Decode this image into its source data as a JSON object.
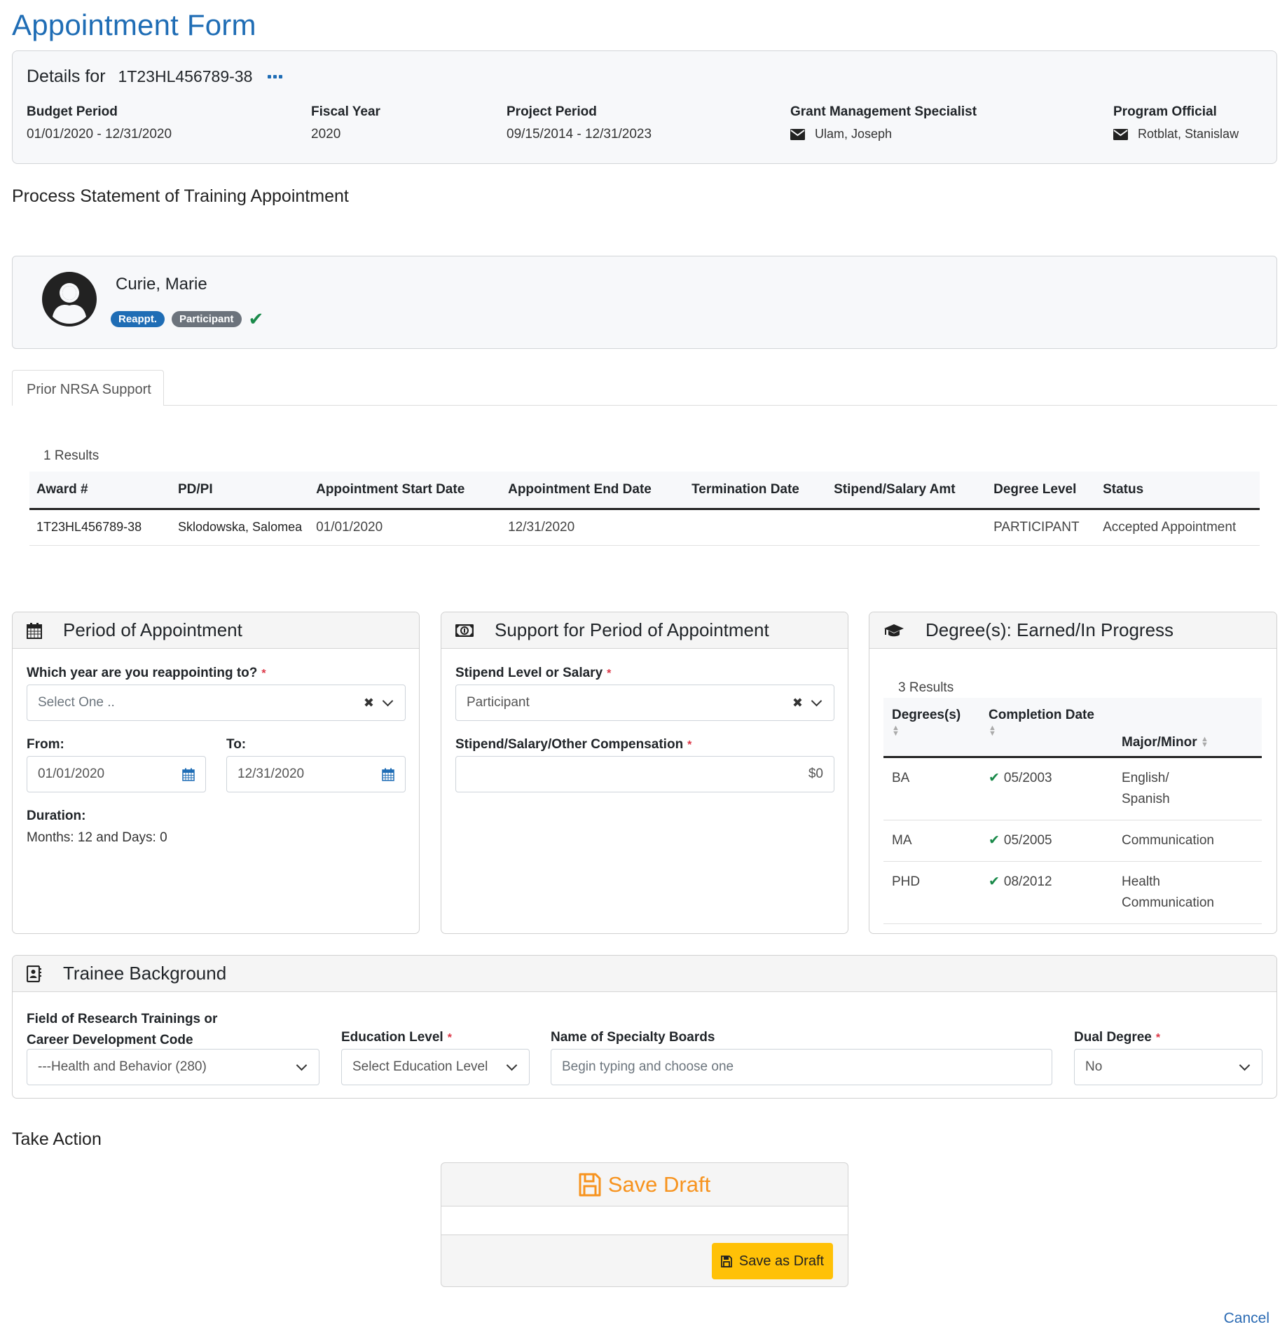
{
  "page": {
    "title": "Appointment Form"
  },
  "details": {
    "heading": "Details for",
    "award_number": "1T23HL456789-38",
    "more_icon": "ellipsis-icon",
    "columns": [
      {
        "label": "Budget Period",
        "value": "01/01/2020 - 12/31/2020"
      },
      {
        "label": "Fiscal Year",
        "value": "2020"
      },
      {
        "label": "Project Period",
        "value": "09/15/2014 - 12/31/2023"
      },
      {
        "label": "Grant Management Specialist",
        "value": "Ulam, Joseph",
        "icon": "envelope-icon"
      },
      {
        "label": "Program Official",
        "value": "Rotblat, Stanislaw",
        "icon": "envelope-icon"
      }
    ]
  },
  "process_title": "Process Statement of Training Appointment",
  "person": {
    "name": "Curie, Marie",
    "badges": [
      "Reappt.",
      "Participant"
    ],
    "verified_icon": "checkmark-icon",
    "colors": {
      "reappt": "#1f6db5",
      "participant": "#6c737c",
      "check": "#1a8a4a"
    }
  },
  "tabs": [
    {
      "label": "Prior NRSA Support",
      "active": true
    }
  ],
  "prior_support": {
    "results_label": "1 Results",
    "columns": [
      "Award #",
      "PD/PI",
      "Appointment Start Date",
      "Appointment End Date",
      "Termination Date",
      "Stipend/Salary Amt",
      "Degree Level",
      "Status"
    ],
    "rows": [
      [
        "1T23HL456789-38",
        "Sklodowska, Salomea",
        "01/01/2020",
        "12/31/2020",
        "",
        "",
        "PARTICIPANT",
        "Accepted Appointment"
      ]
    ]
  },
  "period_panel": {
    "title": "Period of Appointment",
    "icon": "calendar-icon",
    "year_label": "Which year are you reappointing to?",
    "year_placeholder": "Select One ..",
    "from_label": "From:",
    "from_value": "01/01/2020",
    "to_label": "To:",
    "to_value": "12/31/2020",
    "duration_label": "Duration:",
    "duration_value": "Months: 12 and Days: 0"
  },
  "support_panel": {
    "title": "Support for Period of Appointment",
    "icon": "money-bill-icon",
    "stipend_level_label": "Stipend Level or Salary",
    "stipend_level_value": "Participant",
    "compensation_label": "Stipend/Salary/Other Compensation",
    "compensation_value": "$0"
  },
  "degrees_panel": {
    "title": "Degree(s): Earned/In Progress",
    "icon": "graduation-cap-icon",
    "results_label": "3 Results",
    "columns": [
      "Degrees(s)",
      "Completion Date",
      "Major/Minor"
    ],
    "rows": [
      {
        "degree": "BA",
        "date": "05/2003",
        "major_line1": "English/",
        "major_line2": "Spanish"
      },
      {
        "degree": "MA",
        "date": "05/2005",
        "major_line1": "Communication",
        "major_line2": ""
      },
      {
        "degree": "PHD",
        "date": "08/2012",
        "major_line1": "Health",
        "major_line2": "Communication"
      }
    ]
  },
  "background_panel": {
    "title": "Trainee Background",
    "icon": "address-book-icon",
    "field_label_line1": "Field of Research Trainings or",
    "field_label_line2": "Career Development Code",
    "field_value": "---Health and Behavior (280)",
    "education_label": "Education Level",
    "education_placeholder": "Select Education Level",
    "specialty_label": "Name of Specialty Boards",
    "specialty_placeholder": "Begin typing and choose one",
    "dual_label": "Dual Degree",
    "dual_value": "No"
  },
  "take_action": {
    "title": "Take Action",
    "card_title": "Save Draft",
    "card_icon": "floppy-disk-icon",
    "save_button": "Save as Draft",
    "accent_color": "#f7931e",
    "button_color": "#ffc107"
  },
  "cancel_label": "Cancel",
  "required_mark": "*"
}
